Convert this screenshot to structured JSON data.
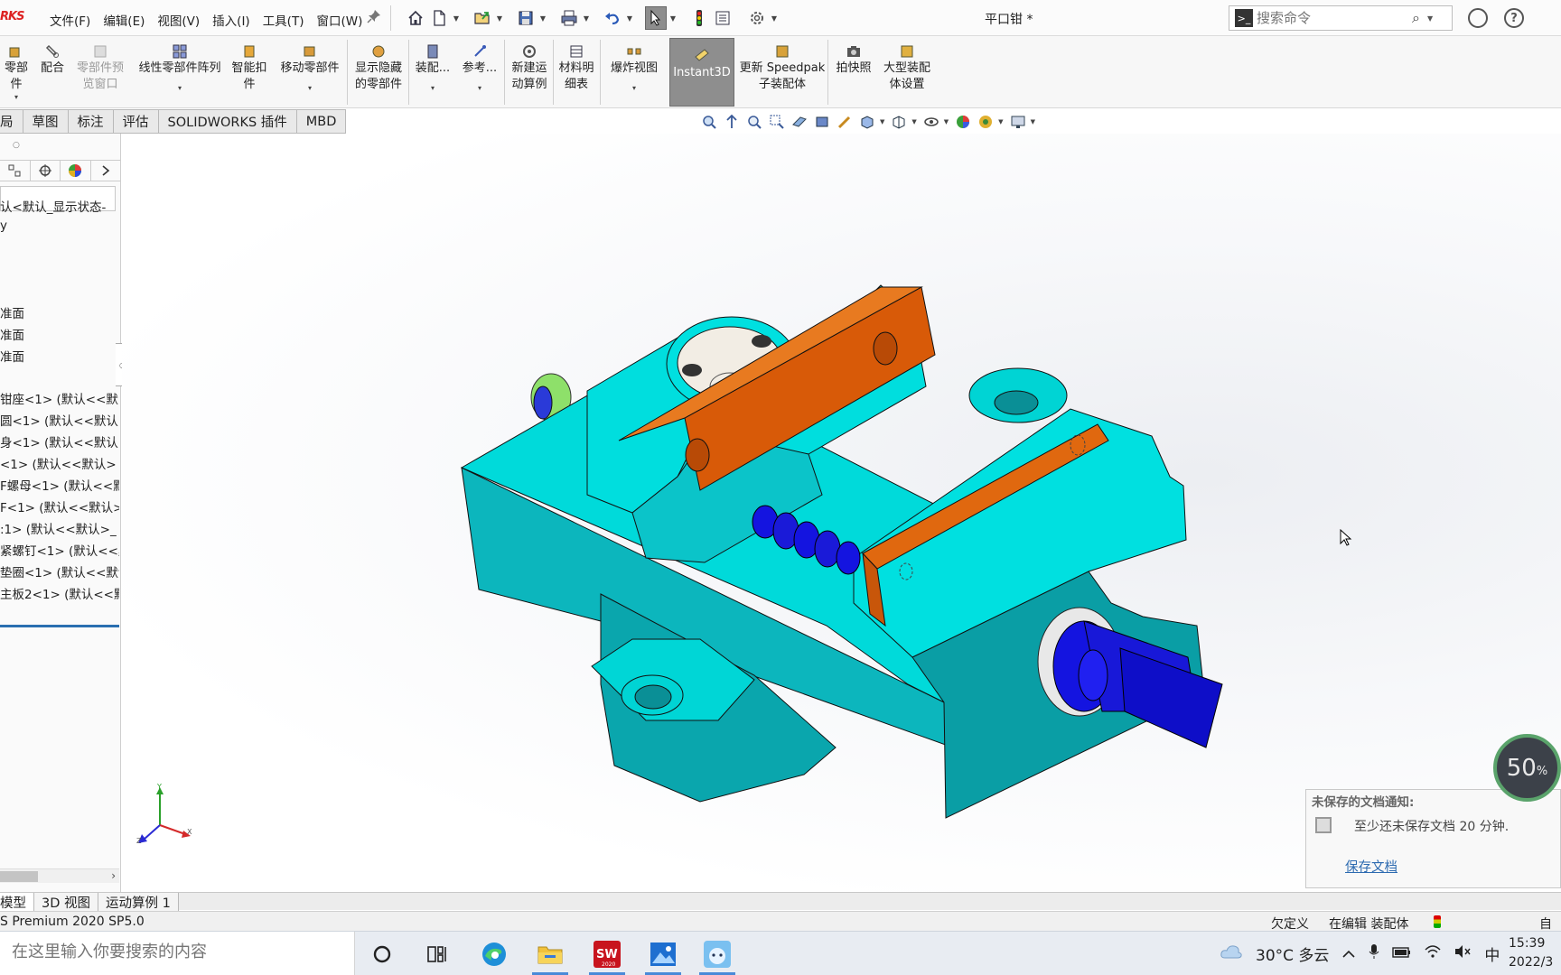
{
  "app": {
    "brand": "RKS",
    "document_title": "平口钳 *"
  },
  "menu": [
    "文件(F)",
    "编辑(E)",
    "视图(V)",
    "插入(I)",
    "工具(T)",
    "窗口(W)"
  ],
  "search": {
    "placeholder": "搜索命令"
  },
  "commands": {
    "insert_components": "零部件",
    "mate": "配合",
    "component_preview_1": "零部件预",
    "component_preview_2": "览窗口",
    "linear_pattern": "线性零部件阵列",
    "smart_fasteners_1": "智能扣",
    "smart_fasteners_2": "件",
    "move_component": "移动零部件",
    "show_hidden_1": "显示隐藏",
    "show_hidden_2": "的零部件",
    "assembly_features": "装配...",
    "reference_geometry": "参考...",
    "new_motion_1": "新建运",
    "new_motion_2": "动算例",
    "bom_1": "材料明",
    "bom_2": "细表",
    "exploded_view": "爆炸视图",
    "instant3d": "Instant3D",
    "speedpak_1": "更新 Speedpak",
    "speedpak_2": "子装配体",
    "snapshot": "拍快照",
    "large_asm_1": "大型装配",
    "large_asm_2": "体设置"
  },
  "tabs": [
    "局",
    "草图",
    "标注",
    "评估",
    "SOLIDWORKS 插件",
    "MBD"
  ],
  "tree": {
    "config": "认<默认_显示状态-",
    "history": "y",
    "planes": [
      "准面",
      "准面",
      "准面"
    ],
    "components": [
      "钳座<1> (默认<<默",
      "圆<1> (默认<<默认>",
      "身<1> (默认<<默认",
      "<1> (默认<<默认>",
      "F螺母<1> (默认<<默",
      "F<1> (默认<<默认>",
      ":1> (默认<<默认>_",
      "紧螺钉<1> (默认<<默",
      "垫圈<1> (默认<<默认",
      "主板2<1> (默认<<默"
    ]
  },
  "notification": {
    "title": "未保存的文档通知:",
    "message": "至少还未保存文档 20 分钟.",
    "link": "保存文档"
  },
  "zoom": {
    "value": "50",
    "unit": "%"
  },
  "bottom_tabs": [
    "模型",
    "3D 视图",
    "运动算例 1"
  ],
  "status": {
    "left": "S Premium 2020 SP5.0",
    "underdefined": "欠定义",
    "editing": "在编辑 装配体",
    "right": "自定"
  },
  "taskbar": {
    "search_placeholder": "在这里输入你要搜索的内容",
    "weather": "30°C  多云",
    "ime": "中",
    "time": "15:39",
    "date": "2022/3"
  },
  "colors": {
    "model_body": "#00d6d6",
    "model_shade": "#0aa3a8",
    "jaw_plate": "#e36a12",
    "screw": "#1414e0",
    "accent": "#2a6fb0"
  }
}
